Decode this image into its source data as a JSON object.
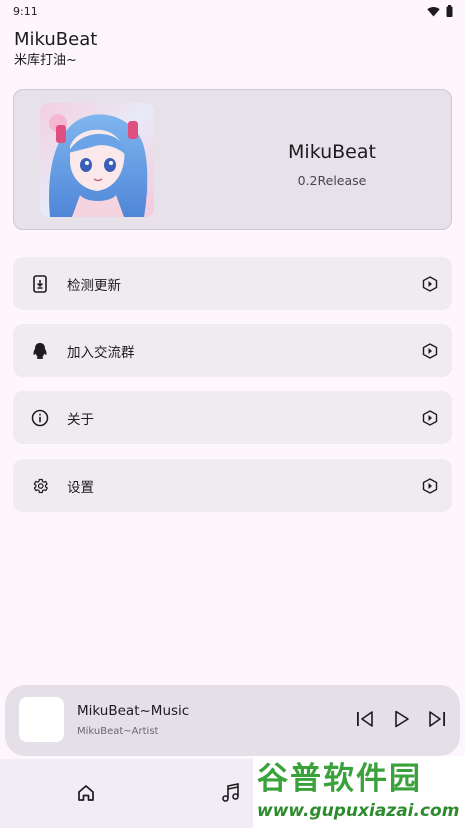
{
  "status_bar": {
    "time": "9:11",
    "icons": [
      "wifi-icon",
      "battery-icon"
    ]
  },
  "header": {
    "title": "MikuBeat",
    "subtitle": "米库打油~"
  },
  "info_card": {
    "name": "MikuBeat",
    "version": "0.2Release",
    "cover_icon": "anime-cover-art"
  },
  "menu": [
    {
      "label": "检测更新",
      "icon": "phone-download-icon"
    },
    {
      "label": "加入交流群",
      "icon": "qq-penguin-icon"
    },
    {
      "label": "关于",
      "icon": "info-icon"
    },
    {
      "label": "设置",
      "icon": "gear-icon"
    }
  ],
  "player": {
    "title": "MikuBeat~Music",
    "artist": "MikuBeat~Artist",
    "controls": [
      "previous-icon",
      "play-icon",
      "next-icon"
    ]
  },
  "bottom_nav": [
    "home-icon",
    "music-note-icon"
  ],
  "watermark": {
    "text": "谷普软件园",
    "url": "www.gupuxiazai.com"
  },
  "colors": {
    "background": "#fdf7fd",
    "card": "#e7e1e9",
    "menu_item": "#f0eaf1",
    "player": "#e5dfe7",
    "watermark_green": "#3aa23a"
  }
}
